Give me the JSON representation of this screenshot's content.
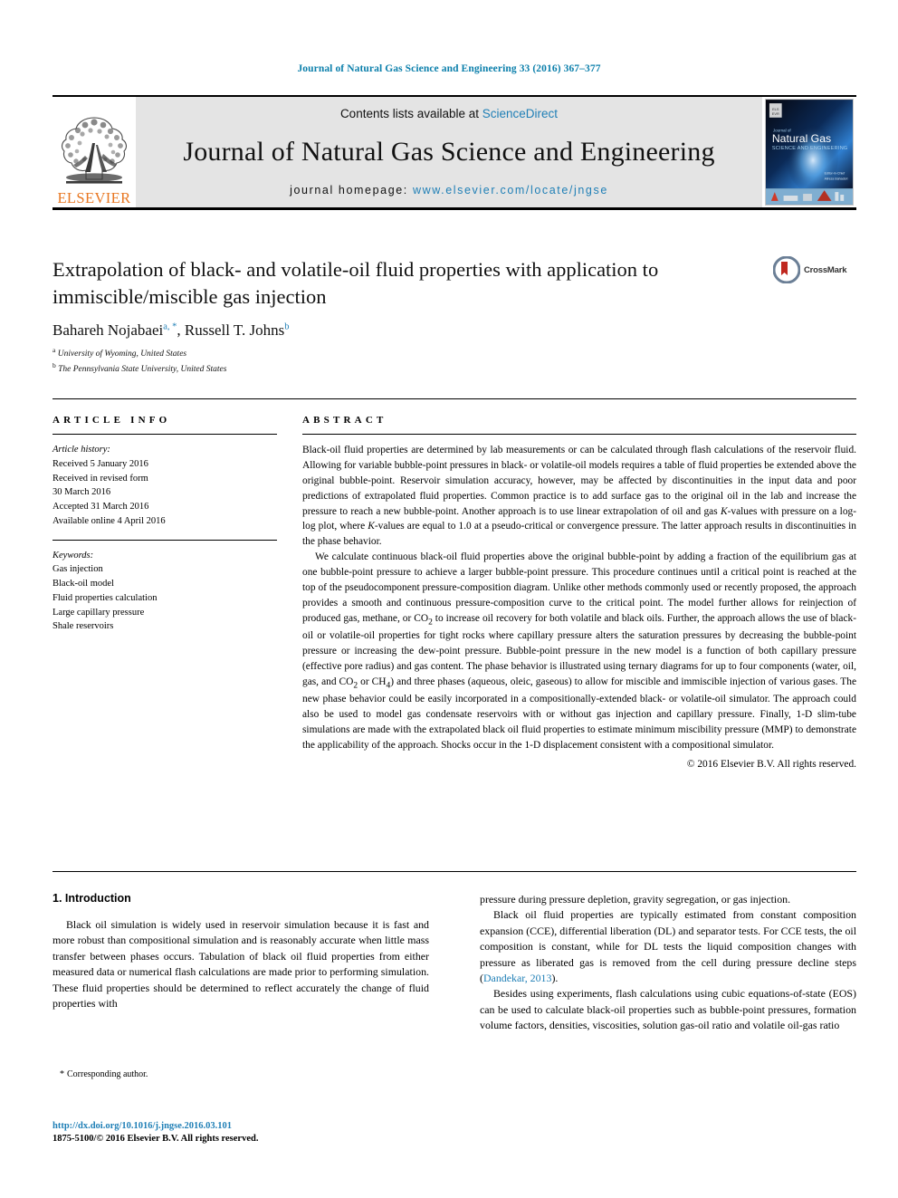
{
  "running_head": "Journal of Natural Gas Science and Engineering 33 (2016) 367–377",
  "masthead": {
    "contents_prefix": "Contents lists available at ",
    "sciencedirect": "ScienceDirect",
    "journal_title": "Journal of Natural Gas Science and Engineering",
    "homepage_prefix": "journal homepage: ",
    "homepage_url": "www.elsevier.com/locate/jngse",
    "publisher": "ELSEVIER",
    "cover_title_top": "Natural Gas",
    "cover_title_sub": "SCIENCE AND ENGINEERING",
    "link_color": "#1f7fb6",
    "band_color": "#e4e4e4",
    "elsevier_orange": "#E87722"
  },
  "article": {
    "title": "Extrapolation of black- and volatile-oil fluid properties with application to immiscible/miscible gas injection",
    "authors_plain": "Bahareh Nojabaei",
    "author1": "Bahareh Nojabaei",
    "author1_marks": "a, *",
    "author2": "Russell T. Johns",
    "author2_marks": "b",
    "affiliation_a_mark": "a",
    "affiliation_a": "University of Wyoming, United States",
    "affiliation_b_mark": "b",
    "affiliation_b": "The Pennsylvania State University, United States",
    "crossmark_label": "CrossMark"
  },
  "info": {
    "heading": "ARTICLE INFO",
    "history_title": "Article history:",
    "history": [
      "Received 5 January 2016",
      "Received in revised form",
      "30 March 2016",
      "Accepted 31 March 2016",
      "Available online 4 April 2016"
    ],
    "keywords_title": "Keywords:",
    "keywords": [
      "Gas injection",
      "Black-oil model",
      "Fluid properties calculation",
      "Large capillary pressure",
      "Shale reservoirs"
    ]
  },
  "abstract": {
    "heading": "ABSTRACT",
    "paragraphs": [
      "Black-oil fluid properties are determined by lab measurements or can be calculated through flash calculations of the reservoir fluid. Allowing for variable bubble-point pressures in black- or volatile-oil models requires a table of fluid properties be extended above the original bubble-point. Reservoir simulation accuracy, however, may be affected by discontinuities in the input data and poor predictions of extrapolated fluid properties. Common practice is to add surface gas to the original oil in the lab and increase the pressure to reach a new bubble-point. Another approach is to use linear extrapolation of oil and gas K-values with pressure on a log-log plot, where K-values are equal to 1.0 at a pseudo-critical or convergence pressure. The latter approach results in discontinuities in the phase behavior.",
      "We calculate continuous black-oil fluid properties above the original bubble-point by adding a fraction of the equilibrium gas at one bubble-point pressure to achieve a larger bubble-point pressure. This procedure continues until a critical point is reached at the top of the pseudocomponent pressure-composition diagram. Unlike other methods commonly used or recently proposed, the approach provides a smooth and continuous pressure-composition curve to the critical point. The model further allows for reinjection of produced gas, methane, or CO2 to increase oil recovery for both volatile and black oils. Further, the approach allows the use of black-oil or volatile-oil properties for tight rocks where capillary pressure alters the saturation pressures by decreasing the bubble-point pressure or increasing the dew-point pressure. Bubble-point pressure in the new model is a function of both capillary pressure (effective pore radius) and gas content. The phase behavior is illustrated using ternary diagrams for up to four components (water, oil, gas, and CO2 or CH4) and three phases (aqueous, oleic, gaseous) to allow for miscible and immiscible injection of various gases. The new phase behavior could be easily incorporated in a compositionally-extended black- or volatile-oil simulator. The approach could also be used to model gas condensate reservoirs with or without gas injection and capillary pressure. Finally, 1-D slim-tube simulations are made with the extrapolated black oil fluid properties to estimate minimum miscibility pressure (MMP) to demonstrate the applicability of the approach. Shocks occur in the 1-D displacement consistent with a compositional simulator."
    ],
    "copyright": "© 2016 Elsevier B.V. All rights reserved."
  },
  "body": {
    "section_number_title": "1. Introduction",
    "left_paragraphs": [
      "Black oil simulation is widely used in reservoir simulation because it is fast and more robust than compositional simulation and is reasonably accurate when little mass transfer between phases occurs. Tabulation of black oil fluid properties from either measured data or numerical flash calculations are made prior to performing simulation. These fluid properties should be determined to reflect accurately the change of fluid properties with"
    ],
    "right_paragraphs": [
      "pressure during pressure depletion, gravity segregation, or gas injection.",
      "Black oil fluid properties are typically estimated from constant composition expansion (CCE), differential liberation (DL) and separator tests. For CCE tests, the oil composition is constant, while for DL tests the liquid composition changes with pressure as liberated gas is removed from the cell during pressure decline steps (Dandekar, 2013).",
      "Besides using experiments, flash calculations using cubic equations-of-state (EOS) can be used to calculate black-oil properties such as bubble-point pressures, formation volume factors, densities, viscosities, solution gas-oil ratio and volatile oil-gas ratio"
    ],
    "citation_text": "Dandekar, 2013"
  },
  "footer": {
    "corresponding_mark": "*",
    "corresponding_author": "Corresponding author.",
    "doi": "http://dx.doi.org/10.1016/j.jngse.2016.03.101",
    "issn_line": "1875-5100/© 2016 Elsevier B.V. All rights reserved."
  }
}
